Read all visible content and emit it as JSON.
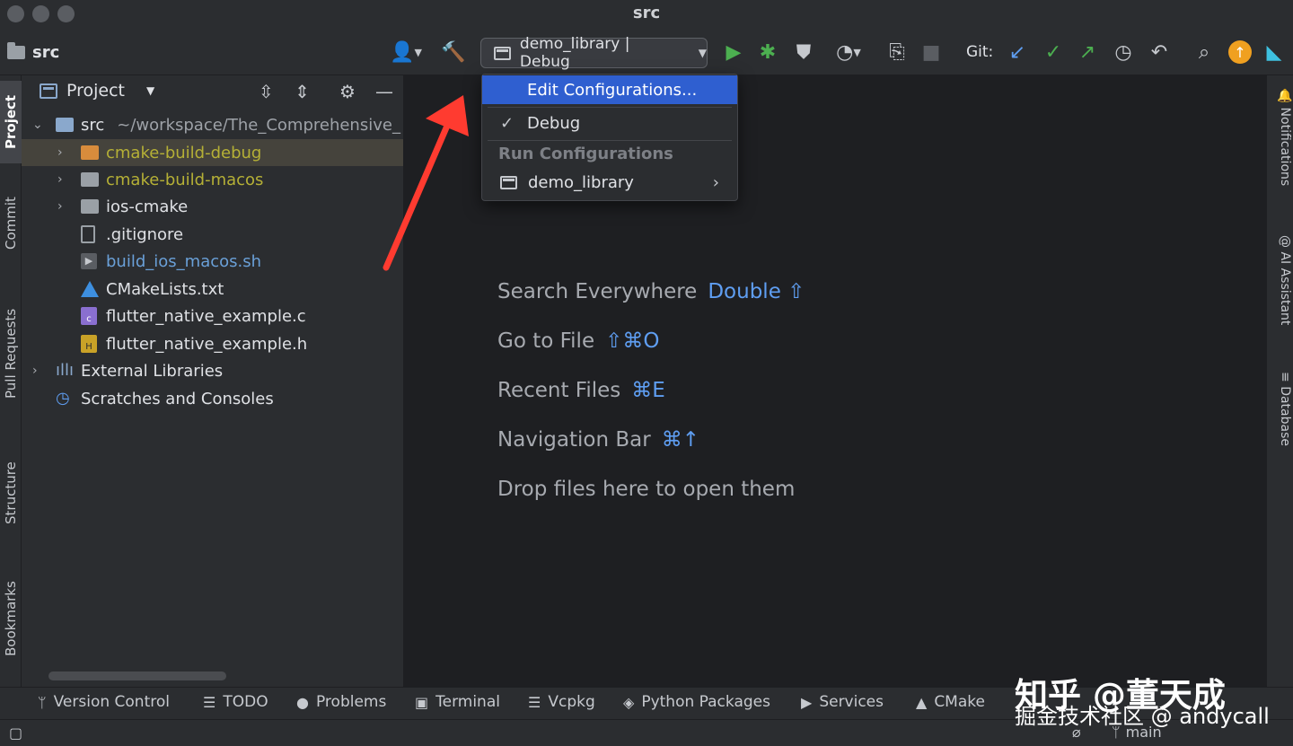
{
  "window": {
    "title": "src"
  },
  "toolbar": {
    "breadcrumb": "src",
    "run_config": "demo_library | Debug",
    "git_label": "Git:"
  },
  "left_strip": [
    "Project",
    "Commit",
    "Pull Requests",
    "Structure",
    "Bookmarks"
  ],
  "right_strip": [
    "Notifications",
    "AI Assistant",
    "Database"
  ],
  "project_panel": {
    "title": "Project",
    "tree": [
      {
        "name": "src",
        "hint": "~/workspace/The_Comprehensive_"
      },
      {
        "name": "cmake-build-debug"
      },
      {
        "name": "cmake-build-macos"
      },
      {
        "name": "ios-cmake"
      },
      {
        "name": ".gitignore"
      },
      {
        "name": "build_ios_macos.sh"
      },
      {
        "name": "CMakeLists.txt"
      },
      {
        "name": "flutter_native_example.c"
      },
      {
        "name": "flutter_native_example.h"
      },
      {
        "name": "External Libraries"
      },
      {
        "name": "Scratches and Consoles"
      }
    ]
  },
  "dropdown": {
    "edit_configurations": "Edit Configurations...",
    "check_mark": "✓",
    "debug": "Debug",
    "section_header": "Run Configurations",
    "run_item": "demo_library"
  },
  "editor_hints": [
    {
      "label": "Search Everywhere",
      "key": "Double ⇧"
    },
    {
      "label": "Go to File",
      "key": "⇧⌘O"
    },
    {
      "label": "Recent Files",
      "key": "⌘E"
    },
    {
      "label": "Navigation Bar",
      "key": "⌘↑"
    },
    {
      "label": "Drop files here to open them",
      "key": ""
    }
  ],
  "bottom_tabs": [
    "Version Control",
    "TODO",
    "Problems",
    "Terminal",
    "Vcpkg",
    "Python Packages",
    "Services",
    "CMake"
  ],
  "status_bar": {
    "branch": "main"
  },
  "watermark": {
    "line1": "知乎 @董天成",
    "line2": "掘金技术社区 @ andycall"
  },
  "colors": {
    "accent": "#2f5fd0",
    "run_green": "#4caf50",
    "excluded_yellow": "#b5b036",
    "arrow_red": "#ff3b30",
    "link_blue": "#5f9ef2"
  }
}
